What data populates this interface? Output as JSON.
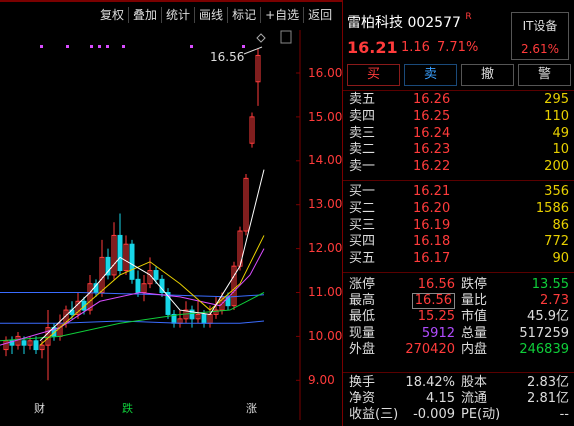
{
  "toolbar": {
    "items": [
      "复权",
      "叠加",
      "统计",
      "画线",
      "标记",
      "+自选",
      "返回"
    ]
  },
  "chart": {
    "y_ticks": [
      "16.00",
      "15.00",
      "14.00",
      "13.00",
      "12.00",
      "11.00",
      "10.00",
      "9.00"
    ],
    "high_label": "16.56",
    "events": [
      "财",
      "跌",
      "涨"
    ],
    "colors": {
      "up": "#ff3b3b",
      "down": "#18d6e8",
      "ma5": "#ffffff",
      "ma10": "#e8d000",
      "ma20": "#d84cff",
      "ma60": "#0fce3a",
      "ma120": "#3a6cff"
    }
  },
  "stock": {
    "name": "雷柏科技",
    "code": "002577",
    "badge": "R",
    "price": "16.21",
    "change": "1.16",
    "change_pct": "7.71%",
    "sector": "IT设备",
    "sector_pct": "2.61%"
  },
  "actions": [
    "买",
    "卖",
    "撤",
    "警"
  ],
  "sell_orders": [
    {
      "label": "卖五",
      "price": "16.26",
      "vol": "295"
    },
    {
      "label": "卖四",
      "price": "16.25",
      "vol": "110"
    },
    {
      "label": "卖三",
      "price": "16.24",
      "vol": "49"
    },
    {
      "label": "卖二",
      "price": "16.23",
      "vol": "10"
    },
    {
      "label": "卖一",
      "price": "16.22",
      "vol": "200"
    }
  ],
  "buy_orders": [
    {
      "label": "买一",
      "price": "16.21",
      "vol": "356"
    },
    {
      "label": "买二",
      "price": "16.20",
      "vol": "1586"
    },
    {
      "label": "买三",
      "price": "16.19",
      "vol": "86"
    },
    {
      "label": "买四",
      "price": "16.18",
      "vol": "772"
    },
    {
      "label": "买五",
      "price": "16.17",
      "vol": "90"
    }
  ],
  "stats": [
    {
      "l1": "涨停",
      "v1": "16.56",
      "c1": "red",
      "l2": "跌停",
      "v2": "13.55",
      "c2": "green"
    },
    {
      "l1": "最高",
      "v1": "16.56",
      "c1": "red",
      "l2": "量比",
      "v2": "2.73",
      "c2": "red",
      "box1": true
    },
    {
      "l1": "最低",
      "v1": "15.25",
      "c1": "red",
      "l2": "市值",
      "v2": "45.9亿",
      "c2": "white"
    },
    {
      "l1": "现量",
      "v1": "5912",
      "c1": "purple",
      "l2": "总量",
      "v2": "517259",
      "c2": "white"
    },
    {
      "l1": "外盘",
      "v1": "270420",
      "c1": "red",
      "l2": "内盘",
      "v2": "246839",
      "c2": "green"
    }
  ],
  "stats2": [
    {
      "l1": "换手",
      "v1": "18.42%",
      "c1": "white",
      "l2": "股本",
      "v2": "2.83亿",
      "c2": "white"
    },
    {
      "l1": "净资",
      "v1": "4.15",
      "c1": "white",
      "l2": "流通",
      "v2": "2.81亿",
      "c2": "white"
    },
    {
      "l1": "收益(三)",
      "v1": "-0.009",
      "c1": "white",
      "l2": "PE(动)",
      "v2": "--",
      "c2": "white"
    }
  ]
}
